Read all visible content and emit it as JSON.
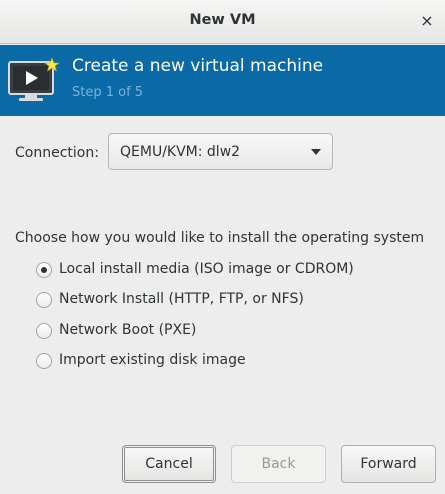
{
  "window": {
    "title": "New VM",
    "close_icon": "close-icon",
    "close_glyph": "×"
  },
  "banner": {
    "icon": "monitor-play-icon",
    "title": "Create a new virtual machine",
    "step": "Step 1 of 5",
    "background_color": "#0a6aa6",
    "step_color": "#78b3dd"
  },
  "connection": {
    "label": "Connection:",
    "value": "QEMU/KVM: dlw2"
  },
  "install": {
    "prompt": "Choose how you would like to install the operating system",
    "options": [
      {
        "label": "Local install media (ISO image or CDROM)",
        "selected": true
      },
      {
        "label": "Network Install (HTTP, FTP, or NFS)",
        "selected": false
      },
      {
        "label": "Network Boot (PXE)",
        "selected": false
      },
      {
        "label": "Import existing disk image",
        "selected": false
      }
    ]
  },
  "buttons": {
    "cancel": "Cancel",
    "back": "Back",
    "forward": "Forward"
  }
}
